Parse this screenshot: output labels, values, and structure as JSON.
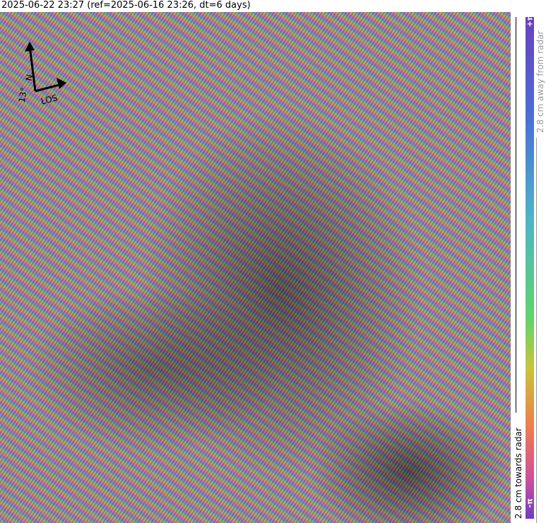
{
  "title": "2025-06-22 23:27 (ref=2025-06-16 23:26, dt=6 days)",
  "north_arrow": {
    "n_label": "N",
    "angle_label": "13°",
    "los_label": "LOS"
  },
  "colorbar": {
    "top_label": "+π",
    "bottom_label": "-π",
    "away_label": "2.8 cm away from radar",
    "towards_label": "2.8 cm towards radar",
    "colors": [
      "#6b3fbe",
      "#4a6fd6",
      "#4fb3c8",
      "#5fd46a",
      "#c9c43a",
      "#f07a4f",
      "#d04f9e"
    ]
  }
}
